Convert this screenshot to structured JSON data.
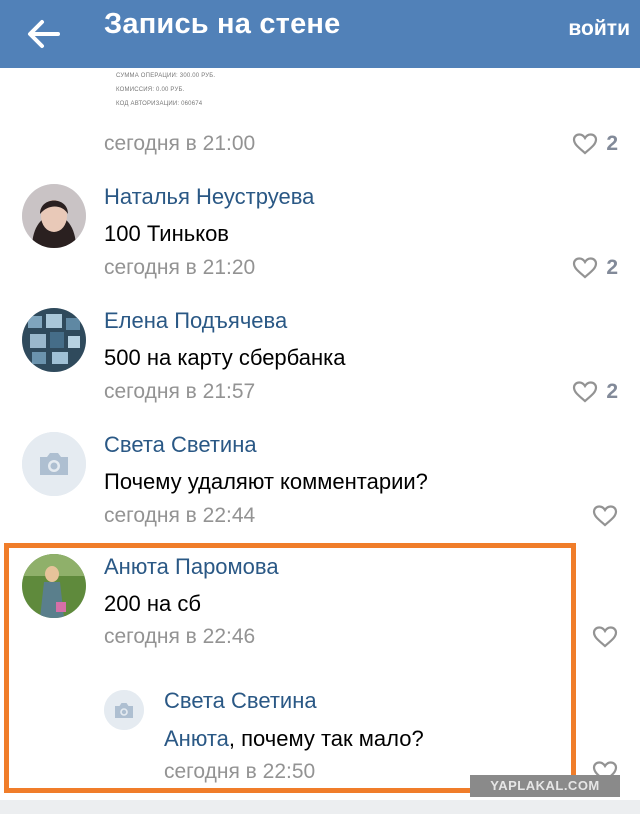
{
  "header": {
    "title": "Запись на стене",
    "login_label": "войти",
    "back_icon": "arrow-left-icon",
    "bg_color": "#5181b8"
  },
  "receipt": {
    "lines": [
      "СУММА ОПЕРАЦИИ: 300.00 РУБ.",
      "КОМИССИЯ: 0.00 РУБ.",
      "КОД АВТОРИЗАЦИИ: 060674"
    ]
  },
  "comments": [
    {
      "time": "сегодня в 21:00",
      "likes": "2"
    },
    {
      "author": "Наталья Неуструева",
      "text": "100 Тиньков",
      "time": "сегодня в 21:20",
      "likes": "2"
    },
    {
      "author": "Елена Подъячева",
      "text": "500 на карту сбербанка",
      "time": "сегодня в 21:57",
      "likes": "2"
    },
    {
      "author": "Света Светина",
      "text": "Почему удаляют комментарии?",
      "time": "сегодня в 22:44"
    },
    {
      "author": "Анюта Паромова",
      "text": "200 на сб",
      "time": "сегодня в 22:46"
    },
    {
      "author": "Света Светина",
      "mention": "Анюта",
      "text": ", почему так мало?",
      "time": "сегодня в 22:50"
    }
  ],
  "watermark": "YAPLAKAL.COM",
  "colors": {
    "link": "#2a5885",
    "time": "#939393",
    "highlight": "#f07d2a"
  }
}
